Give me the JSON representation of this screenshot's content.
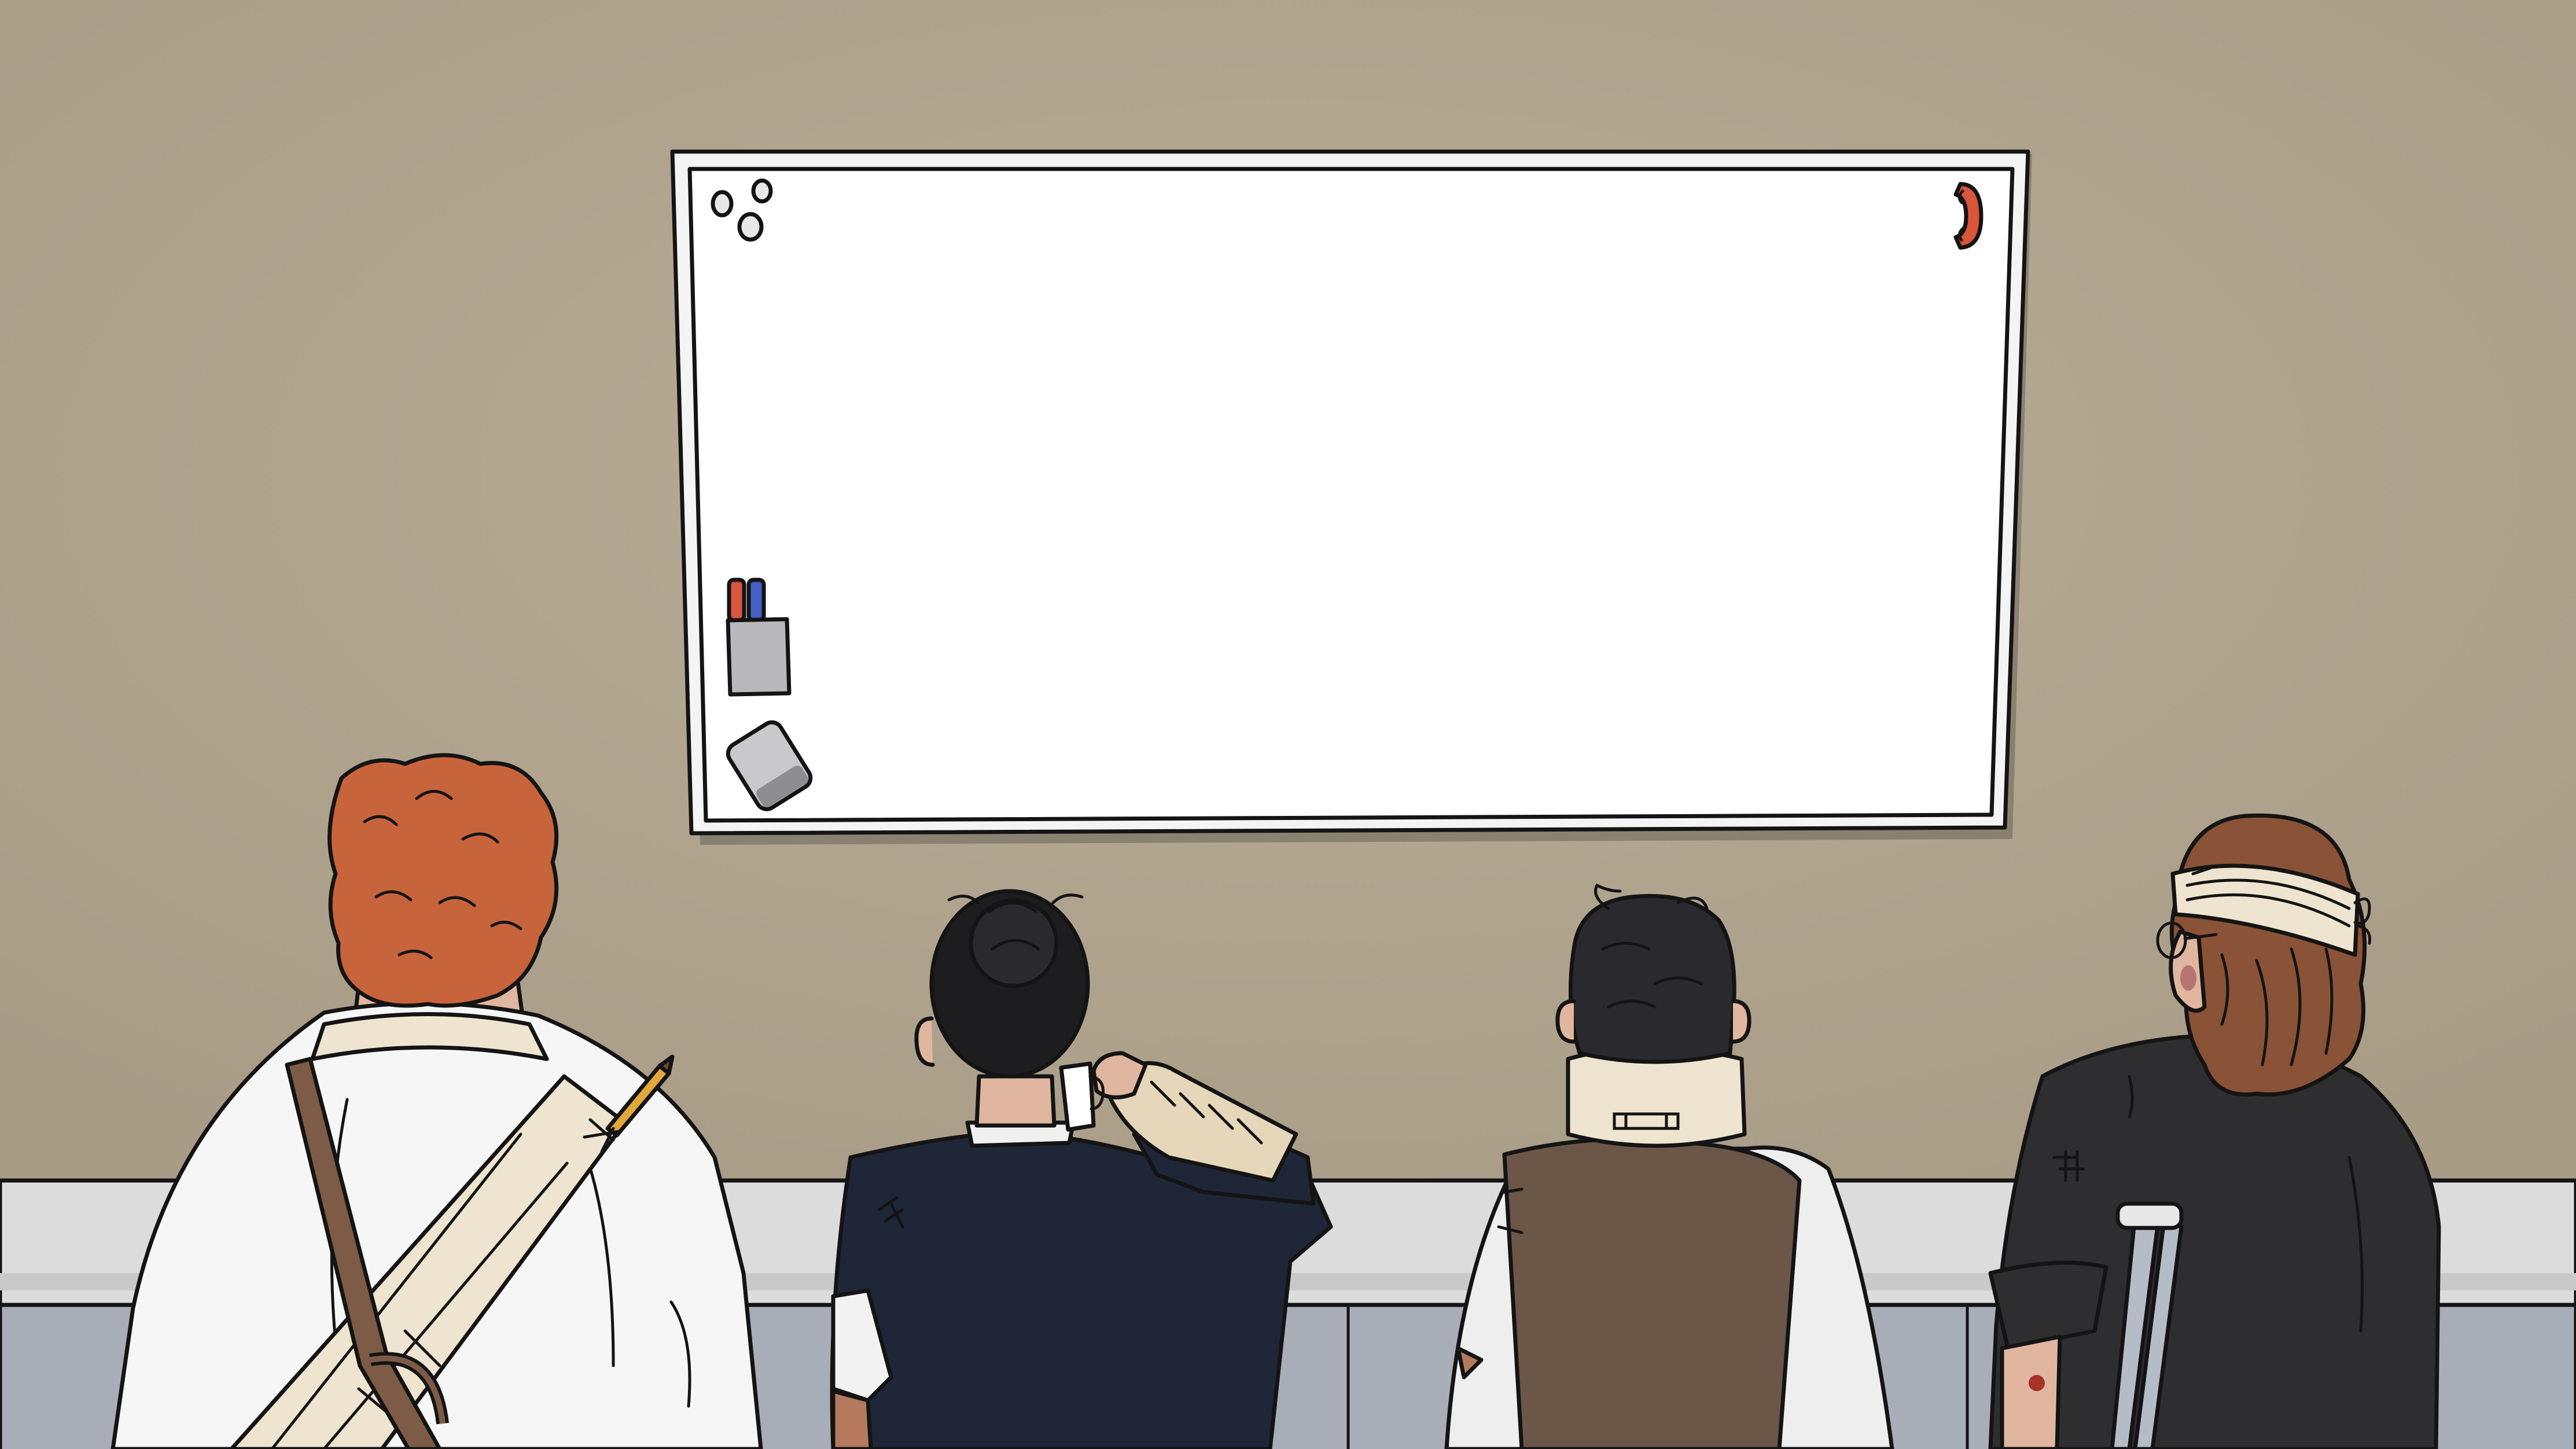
{
  "scene": {
    "colors": {
      "wall": "#b4a893",
      "wainscot": "#dcdcdc",
      "panel": "#a9adb8",
      "board": "#ffffff",
      "red_hair": "#c8643c",
      "navy_jacket": "#1f2638",
      "brown_vest": "#6b5648",
      "dark_sweater": "#2e2e30",
      "bandage": "#efe4cf"
    },
    "icons": [
      "magnet-icon",
      "phone-magnet-icon",
      "marker-cup-icon",
      "eraser-icon",
      "pencil-icon",
      "coffee-mug-icon",
      "crutch-icon",
      "glasses-icon"
    ]
  }
}
